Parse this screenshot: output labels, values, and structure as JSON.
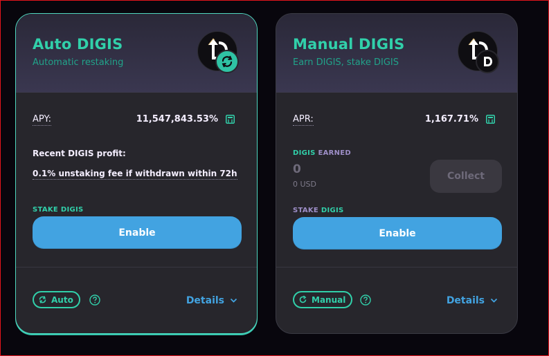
{
  "auto_card": {
    "title": "Auto DIGIS",
    "subtitle": "Automatic restaking",
    "apy_label": "APY:",
    "apy_value": "11,547,843.53%",
    "recent_profit_label": "Recent DIGIS profit:",
    "fee_note": "0.1% unstaking fee if withdrawn within 72h",
    "stake_prefix": "STAKE",
    "stake_token": "DIGIS",
    "enable_label": "Enable",
    "tag_label": "Auto",
    "details_label": "Details"
  },
  "manual_card": {
    "title": "Manual DIGIS",
    "subtitle": "Earn DIGIS, stake DIGIS",
    "apr_label": "APR:",
    "apr_value": "1,167.71%",
    "earned_token": "DIGIS",
    "earned_suffix": "EARNED",
    "earned_amount": "0",
    "earned_usd": "0 USD",
    "collect_label": "Collect",
    "stake_prefix": "STAKE",
    "stake_token": "DIGIS",
    "enable_label": "Enable",
    "tag_label": "Manual",
    "details_label": "Details"
  },
  "colors": {
    "accent_teal": "#31d0aa",
    "button_blue": "#42a3e1",
    "card_bg": "#27262c",
    "page_bg": "#08060d"
  }
}
